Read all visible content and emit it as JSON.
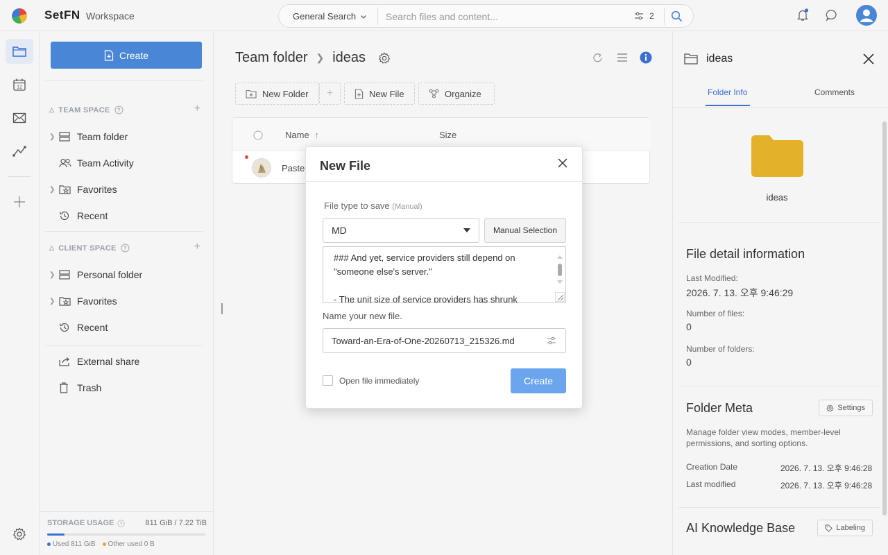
{
  "header": {
    "brand": "SetFN",
    "workspace": "Workspace",
    "search_scope": "General Search",
    "search_placeholder": "Search files and content...",
    "filter_count": "2"
  },
  "sidebar": {
    "create_label": "Create",
    "team_space_label": "TEAM SPACE",
    "team_items": [
      {
        "label": "Team folder",
        "icon": "storage-icon"
      },
      {
        "label": "Team Activity",
        "icon": "people-icon"
      },
      {
        "label": "Favorites",
        "icon": "star-folder-icon"
      },
      {
        "label": "Recent",
        "icon": "history-icon"
      }
    ],
    "client_space_label": "CLIENT SPACE",
    "client_items": [
      {
        "label": "Personal folder",
        "icon": "storage-icon"
      },
      {
        "label": "Favorites",
        "icon": "star-folder-icon"
      },
      {
        "label": "Recent",
        "icon": "history-icon"
      }
    ],
    "other_items": [
      {
        "label": "External share",
        "icon": "share-icon"
      },
      {
        "label": "Trash",
        "icon": "trash-icon"
      }
    ],
    "storage": {
      "label": "STORAGE USAGE",
      "amount": "811 GiB / 7.22 TiB",
      "used_label": "Used 811 GiB",
      "other_label": "Other used 0 B",
      "used_fraction": 0.11,
      "used_color": "#3b6fd0",
      "other_color": "#f0a030"
    }
  },
  "main": {
    "breadcrumb_root": "Team folder",
    "breadcrumb_current": "ideas",
    "toolbar": {
      "new_folder": "New Folder",
      "new_file": "New File",
      "organize": "Organize"
    },
    "table": {
      "col_name": "Name",
      "col_size": "Size",
      "rows": [
        {
          "name": "Pastec"
        }
      ]
    }
  },
  "right_panel": {
    "title": "ideas",
    "tabs": [
      "Folder Info",
      "Comments"
    ],
    "folder_name": "ideas",
    "detail_title": "File detail information",
    "last_modified_label": "Last Modified:",
    "last_modified_value": "2026. 7. 13. 오후 9:46:29",
    "files_label": "Number of files:",
    "files_value": "0",
    "folders_label": "Number of folders:",
    "folders_value": "0",
    "meta_title": "Folder Meta",
    "meta_button": "Settings",
    "meta_desc": "Manage folder view modes, member-level permissions, and sorting options.",
    "creation_label": "Creation Date",
    "creation_value": "2026. 7. 13. 오후 9:46:28",
    "modified_label": "Last modified",
    "modified_value": "2026. 7. 13. 오후 9:46:28",
    "kb_title": "AI Knowledge Base",
    "kb_button": "Labeling",
    "folder_color": "#e3b12a"
  },
  "modal": {
    "title": "New File",
    "type_label": "File type to save",
    "type_sub": "(Manual)",
    "type_value": "MD",
    "manual_button": "Manual Selection",
    "preview_line1": "### And yet, service providers still depend on \"someone else's server.\"",
    "preview_line2": "- The unit size of service providers has shrunk",
    "name_label": "Name your new file.",
    "name_value": "Toward-an-Era-of-One-20260713_215326.md",
    "open_label": "Open file immediately",
    "create_button": "Create",
    "accent_color": "#6aa5ee"
  }
}
